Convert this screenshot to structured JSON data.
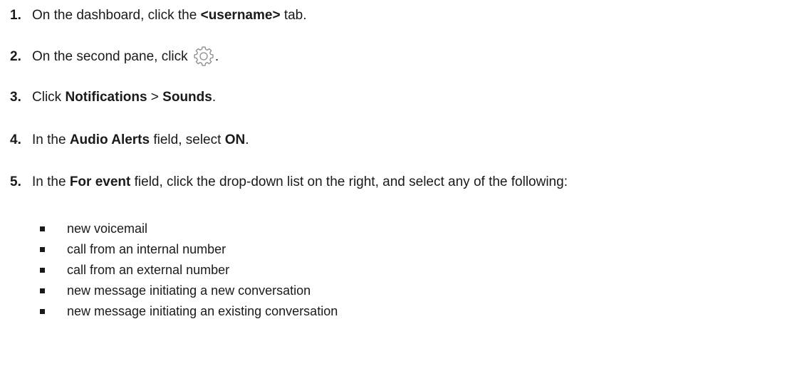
{
  "steps": [
    {
      "num": "1.",
      "parts": [
        {
          "t": "On the dashboard, click the "
        },
        {
          "t": "<username>",
          "b": true
        },
        {
          "t": " tab."
        }
      ]
    },
    {
      "num": "2.",
      "parts": [
        {
          "t": "On the second pane, click "
        },
        {
          "icon": "gear-icon"
        },
        {
          "t": "."
        }
      ]
    },
    {
      "num": "3.",
      "parts": [
        {
          "t": "Click "
        },
        {
          "t": "Notifications",
          "b": true
        },
        {
          "t": " > "
        },
        {
          "t": "Sounds",
          "b": true
        },
        {
          "t": "."
        }
      ]
    },
    {
      "num": "4.",
      "parts": [
        {
          "t": "In the "
        },
        {
          "t": "Audio Alerts",
          "b": true
        },
        {
          "t": " field, select "
        },
        {
          "t": "ON",
          "b": true
        },
        {
          "t": "."
        }
      ]
    },
    {
      "num": "5.",
      "parts": [
        {
          "t": "In the "
        },
        {
          "t": "For event",
          "b": true
        },
        {
          "t": " field, click the drop-down list on the right, and select any of the following:"
        }
      ]
    }
  ],
  "bullets": [
    "new voicemail",
    "call from an internal number",
    "call from an external number",
    "new message initiating a new conversation",
    "new message initiating an existing conversation"
  ],
  "colors": {
    "text": "#1a1a1a",
    "icon_stroke": "#8a8a8a"
  }
}
